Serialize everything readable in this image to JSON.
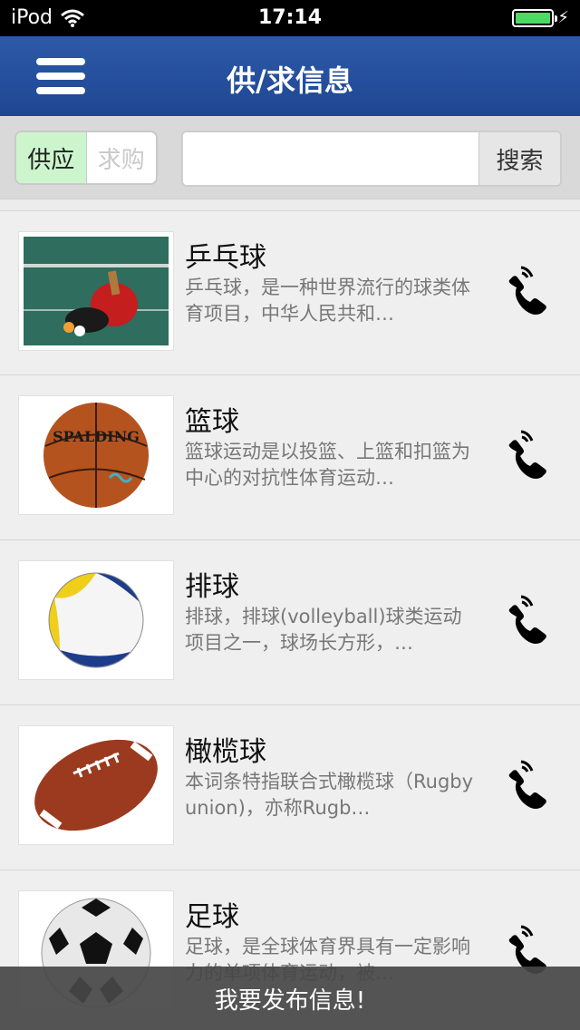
{
  "status": {
    "carrier": "iPod",
    "time": "17:14"
  },
  "nav": {
    "title": "供/求信息"
  },
  "search": {
    "tab_supply": "供应",
    "tab_demand": "求购",
    "value": "",
    "button": "搜索"
  },
  "items": [
    {
      "title": "乒乓球",
      "desc": "乒乓球，是一种世界流行的球类体育项目，中华人民共和…",
      "image": "ping-pong-image"
    },
    {
      "title": "篮球",
      "desc": "篮球运动是以投篮、上篮和扣篮为中心的对抗性体育运动…",
      "image": "basketball-image"
    },
    {
      "title": "排球",
      "desc": "排球，排球(volleyball)球类运动项目之一，球场长方形，…",
      "image": "volleyball-image"
    },
    {
      "title": "橄榄球",
      "desc": "本词条特指联合式橄榄球（Rugby union)，亦称Rugb…",
      "image": "rugby-image"
    },
    {
      "title": "足球",
      "desc": "足球，是全球体育界具有一定影响力的单项体育运动，被…",
      "image": "soccer-image"
    }
  ],
  "bottom": {
    "label": "我要发布信息!"
  },
  "colors": {
    "nav": "#2c5aa8",
    "active_tab": "#cdf5cd",
    "battery": "#4cd964"
  }
}
